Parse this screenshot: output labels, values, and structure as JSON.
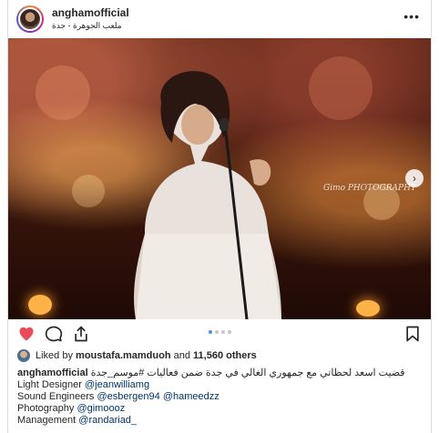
{
  "header": {
    "username": "anghamofficial",
    "location": "ملعب الجوهرة - جدة",
    "more_glyph": "•••"
  },
  "photo": {
    "watermark": "Gimo PHOTOGRAPHY",
    "next_glyph": "›"
  },
  "carousel": {
    "count": 4,
    "active_index": 0
  },
  "likes": {
    "prefix": "Liked by",
    "user": "moustafa.mamduoh",
    "middle": "and",
    "count_text": "11,560 others"
  },
  "caption": {
    "username": "anghamofficial",
    "arabic_text": "قضيت اسعد لحظاتي مع جمهوري الغالي في جدة ضمن فعاليات #موسم_جدة",
    "credits": [
      {
        "role": "Light Designer",
        "handles": [
          "@jeanwilliamg"
        ]
      },
      {
        "role": "Sound Engineers",
        "handles": [
          "@esbergen94",
          "@hameedzz"
        ]
      },
      {
        "role": "Photography",
        "handles": [
          "@gimoooz"
        ]
      },
      {
        "role": "Management",
        "handles": [
          "@randariad_"
        ]
      }
    ]
  },
  "colors": {
    "heart": "#ed4956",
    "link": "#003569",
    "dot_active": "#3897f0"
  }
}
